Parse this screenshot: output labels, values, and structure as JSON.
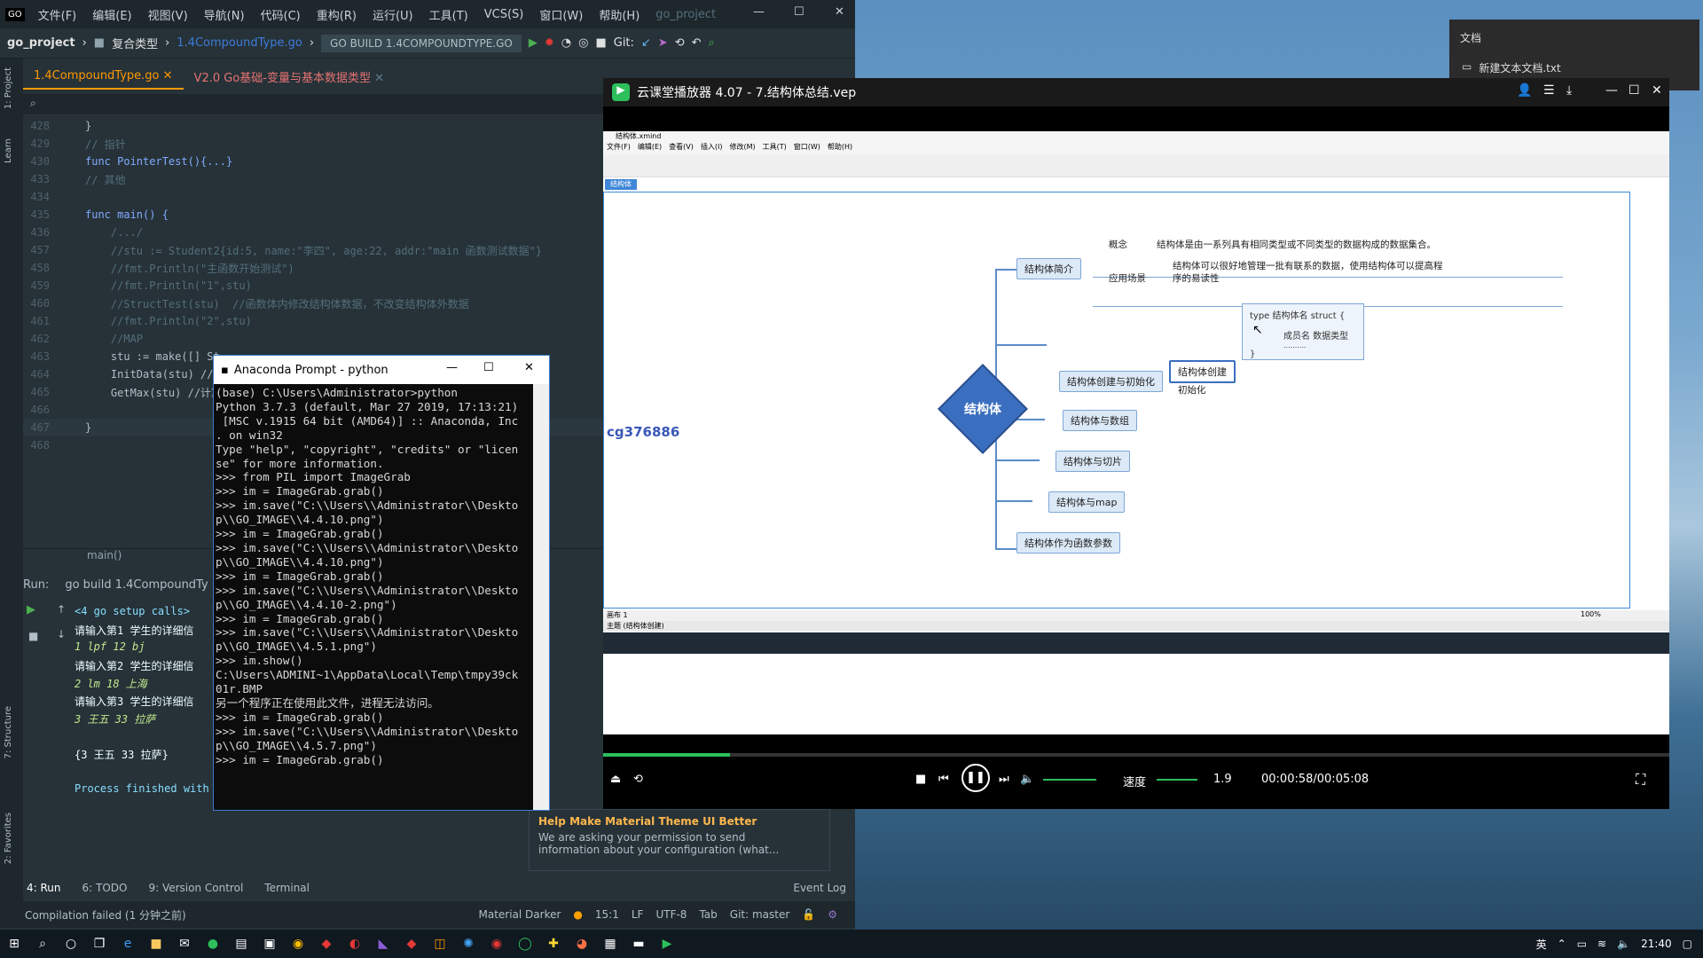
{
  "ide": {
    "menus": [
      "文件(F)",
      "编辑(E)",
      "视图(V)",
      "导航(N)",
      "代码(C)",
      "重构(R)",
      "运行(U)",
      "工具(T)",
      "VCS(S)",
      "窗口(W)",
      "帮助(H)",
      "go_project"
    ],
    "project": "go_project",
    "crumb_folder": "复合类型",
    "crumb_file": "1.4CompoundType.go",
    "run_config": "GO BUILD 1.4COMPOUNDTYPE.GO",
    "git_label": "Git:",
    "tabs": [
      "1.4CompoundType.go",
      "V2.0 Go基础-变量与基本数据类型"
    ],
    "code_lines": [
      {
        "n": "428",
        "t": "}"
      },
      {
        "n": "429",
        "t": "// 指针"
      },
      {
        "n": "430",
        "t": "func PointerTest(){...}"
      },
      {
        "n": "433",
        "t": "// 其他"
      },
      {
        "n": "434",
        "t": ""
      },
      {
        "n": "435",
        "t": "func main() {"
      },
      {
        "n": "436",
        "t": "    /.../"
      },
      {
        "n": "457",
        "t": "    //stu := Student2{id:5, name:\"李四\", age:22, addr:\"main 函数测试数据\"}"
      },
      {
        "n": "458",
        "t": "    //fmt.Println(\"主函数开始测试\")"
      },
      {
        "n": "459",
        "t": "    //fmt.Println(\"1\",stu)"
      },
      {
        "n": "460",
        "t": "    //StructTest(stu)  //函数体内修改结构体数据，不改变结构体外数据"
      },
      {
        "n": "461",
        "t": "    //fmt.Println(\"2\",stu)"
      },
      {
        "n": "462",
        "t": "    //MAP"
      },
      {
        "n": "463",
        "t": "    stu := make([] St"
      },
      {
        "n": "464",
        "t": "    InitData(stu) //"
      },
      {
        "n": "465",
        "t": "    GetMax(stu) //计算"
      },
      {
        "n": "466",
        "t": ""
      },
      {
        "n": "467",
        "t": "}"
      },
      {
        "n": "468",
        "t": ""
      }
    ],
    "breadcrumb_fn": "main()",
    "run_label": "Run:",
    "run_tab": "go build 1.4CompoundTy",
    "run_output": [
      {
        "t": "<4 go setup calls>",
        "c": "g"
      },
      {
        "t": "请输入第1 学生的详细信",
        "c": ""
      },
      {
        "t": "1 lpf 12 bj",
        "c": "i"
      },
      {
        "t": "请输入第2 学生的详细信",
        "c": ""
      },
      {
        "t": "2 lm 18 上海",
        "c": "i"
      },
      {
        "t": "请输入第3 学生的详细信",
        "c": ""
      },
      {
        "t": "3 王五 33 拉萨",
        "c": "i"
      },
      {
        "t": "",
        "c": ""
      },
      {
        "t": "{3 王五 33 拉萨}",
        "c": ""
      },
      {
        "t": "",
        "c": ""
      },
      {
        "t": "Process finished with",
        "c": "g"
      }
    ],
    "bottom_tabs": [
      "4: Run",
      "6: TODO",
      "9: Version Control",
      "Terminal"
    ],
    "event_log": "Event Log",
    "status_text": "Compilation failed (1 分钟之前)",
    "theme": "Material Darker",
    "pos": "15:1",
    "lf": "LF",
    "enc": "UTF-8",
    "tab_kind": "Tab",
    "git_branch": "Git: master",
    "notif_title": "Help Make Material Theme UI Better",
    "notif_body": "We are asking your permission to send information about your configuration (what..."
  },
  "anaconda": {
    "title": "Anaconda Prompt - python",
    "text": "(base) C:\\Users\\Administrator>python\nPython 3.7.3 (default, Mar 27 2019, 17:13:21)\n [MSC v.1915 64 bit (AMD64)] :: Anaconda, Inc\n. on win32\nType \"help\", \"copyright\", \"credits\" or \"licen\nse\" for more information.\n>>> from PIL import ImageGrab\n>>> im = ImageGrab.grab()\n>>> im.save(\"C:\\\\Users\\\\Administrator\\\\Deskto\np\\\\GO_IMAGE\\\\4.4.10.png\")\n>>> im = ImageGrab.grab()\n>>> im.save(\"C:\\\\Users\\\\Administrator\\\\Deskto\np\\\\GO_IMAGE\\\\4.4.10.png\")\n>>> im = ImageGrab.grab()\n>>> im.save(\"C:\\\\Users\\\\Administrator\\\\Deskto\np\\\\GO_IMAGE\\\\4.4.10-2.png\")\n>>> im = ImageGrab.grab()\n>>> im.save(\"C:\\\\Users\\\\Administrator\\\\Deskto\np\\\\GO_IMAGE\\\\4.5.1.png\")\n>>> im.show()\nC:\\Users\\ADMINI~1\\AppData\\Local\\Temp\\tmpy39ck\n01r.BMP\n另一个程序正在使用此文件，进程无法访问。\n>>> im = ImageGrab.grab()\n>>> im.save(\"C:\\\\Users\\\\Administrator\\\\Deskto\np\\\\GO_IMAGE\\\\4.5.7.png\")\n>>> im = ImageGrab.grab()"
  },
  "player": {
    "title": "云课堂播放器 4.07 - 7.结构体总结.vep",
    "xmind_file": "结构体.xmind",
    "xmind_menus": [
      "文件(F)",
      "编辑(E)",
      "查看(V)",
      "插入(I)",
      "修改(M)",
      "工具(T)",
      "窗口(W)",
      "帮助(H)"
    ],
    "xmind_tab": "结构体",
    "watermark": "cg376886",
    "center": "结构体",
    "branches": [
      "结构体简介",
      "结构体创建与初始化",
      "结构体与数组",
      "结构体与切片",
      "结构体与map",
      "结构体作为函数参数"
    ],
    "concept_label": "概念",
    "concept_text": "结构体是由一系列具有相同类型或不同类型的数据构成的数据集合。",
    "scene_label": "应用场景",
    "scene_text1": "结构体可以很好地管理一批有联系的数据，使用结构体可以提高程",
    "scene_text2": "序的易读性",
    "create_label": "结构体创建",
    "init_label": "初始化",
    "code1": "type 结构体名 struct {",
    "code2": "成员名 数据类型",
    "code3": "..........",
    "code4": "}",
    "sheet": "画布 1",
    "zoom": "100%",
    "status_left": "主题 (结构体创建)",
    "speed_label": "速度",
    "speed": "1.9",
    "time": "00:00:58/00:05:08",
    "progress": 0.119
  },
  "explorer": {
    "title": "文档",
    "file": "新建文本文档.txt"
  },
  "taskbar": {
    "time": "21:40",
    "ime": "英"
  }
}
